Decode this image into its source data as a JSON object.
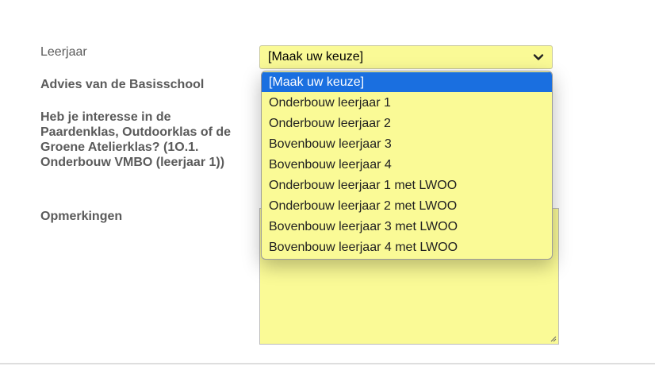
{
  "form": {
    "leerjaar_label": "Leerjaar",
    "advies_label": "Advies van de Basisschool",
    "interesse_label": "Heb je interesse in de Paardenklas, Outdoorklas of de Groene Atelierklas? (1O.1. Onderbouw VMBO (leerjaar 1))",
    "opmerkingen_label": "Opmerkingen"
  },
  "leerjaar_select": {
    "value": "[Maak uw keuze]",
    "options": [
      "[Maak uw keuze]",
      "Onderbouw leerjaar 1",
      "Onderbouw leerjaar 2",
      "Bovenbouw leerjaar 3",
      "Bovenbouw leerjaar 4",
      "Onderbouw leerjaar 1 met LWOO",
      "Onderbouw leerjaar 2 met LWOO",
      "Bovenbouw leerjaar 3 met LWOO",
      "Bovenbouw leerjaar 4 met LWOO"
    ],
    "highlighted": "[Maak uw keuze]"
  },
  "icons": {
    "select_arrow": "chevron-down-icon",
    "textarea_grip": "resize-handle-icon"
  },
  "colors": {
    "field_background": "#fafa96",
    "highlight": "#1a6fe0",
    "label_text": "#5a5a5a"
  }
}
